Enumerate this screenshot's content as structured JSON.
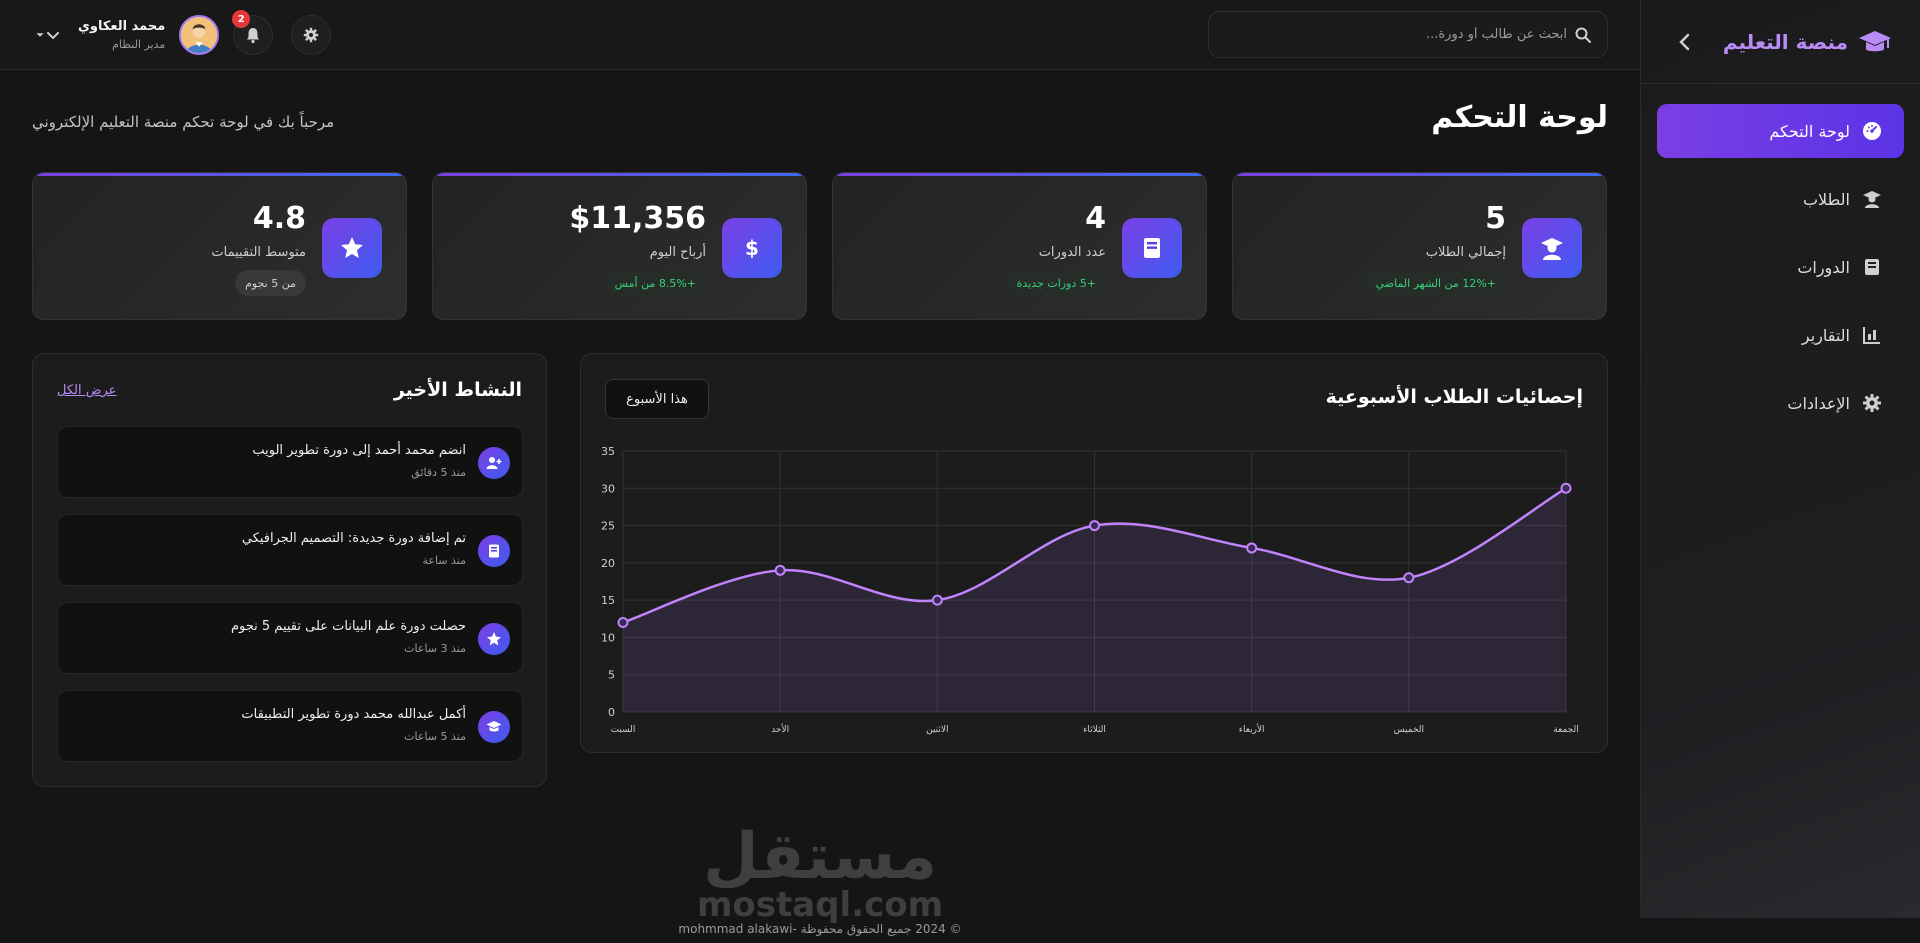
{
  "sidebar": {
    "brand": "منصة التعليم",
    "items": [
      {
        "label": "لوحة التحكم",
        "icon": "gauge-icon",
        "active": true
      },
      {
        "label": "الطلاب",
        "icon": "student-icon"
      },
      {
        "label": "الدورات",
        "icon": "book-icon"
      },
      {
        "label": "التقارير",
        "icon": "chart-icon"
      },
      {
        "label": "الإعدادات",
        "icon": "gear-icon"
      }
    ]
  },
  "topbar": {
    "search_placeholder": "ابحث عن طالب أو دورة...",
    "user_name": "محمد العكاوي",
    "user_role": "مدير النظام",
    "notifications_count": "2"
  },
  "page": {
    "title": "لوحة التحكم",
    "subtitle": "مرحباً بك في لوحة تحكم منصة التعليم الإلكتروني"
  },
  "stats": [
    {
      "value": "5",
      "label": "إجمالي الطلاب",
      "pill": "+12% من الشهر الماضي",
      "icon": "graduate-icon"
    },
    {
      "value": "4",
      "label": "عدد الدورات",
      "pill": "+5 دورات جديدة",
      "icon": "book-icon"
    },
    {
      "value": "$11,356",
      "label": "أرباح اليوم",
      "pill": "+8.5% من أمس",
      "icon": "dollar-icon"
    },
    {
      "value": "4.8",
      "label": "متوسط التقييمات",
      "pill": "من 5 نجوم",
      "icon": "star-icon"
    }
  ],
  "chart_panel": {
    "title": "إحصائيات الطلاب الأسبوعية",
    "button": "هذا الأسبوع"
  },
  "chart_data": {
    "type": "line",
    "categories": [
      "السبت",
      "الأحد",
      "الاثنين",
      "الثلاثاء",
      "الأربعاء",
      "الخميس",
      "الجمعة"
    ],
    "series": [
      {
        "values": [
          12,
          19,
          15,
          25,
          22,
          18,
          30
        ]
      }
    ],
    "ylim": [
      0,
      35
    ],
    "yticks": [
      0,
      5,
      10,
      15,
      20,
      25,
      30,
      35
    ],
    "grid": true,
    "color": "#c084fc"
  },
  "activity": {
    "title": "النشاط الأخير",
    "see_all": "عرض الكل",
    "items": [
      {
        "text": "انضم محمد أحمد إلى دورة تطوير الويب",
        "time": "منذ 5 دقائق",
        "icon": "user-plus-icon"
      },
      {
        "text": "تم إضافة دورة جديدة: التصميم الجرافيكي",
        "time": "منذ ساعة",
        "icon": "book-icon"
      },
      {
        "text": "حصلت دورة علم البيانات على تقييم 5 نجوم",
        "time": "منذ 3 ساعات",
        "icon": "star-icon"
      },
      {
        "text": "أكمل عبدالله محمد دورة تطوير التطبيقات",
        "time": "منذ 5 ساعات",
        "icon": "graduation-cap-icon"
      }
    ]
  },
  "footer": {
    "watermark_ar": "مستقل",
    "watermark_en": "mostaql.com",
    "copyright": "© 2024 جميع الحقوق محفوظة -mohmmad alakawi"
  }
}
